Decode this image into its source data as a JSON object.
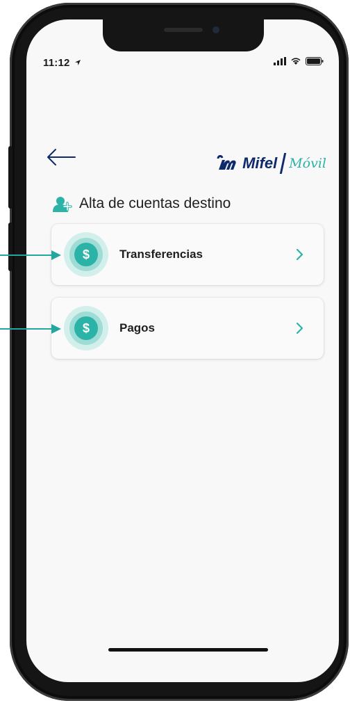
{
  "status": {
    "time": "11:12"
  },
  "header": {
    "brand": "Mifel",
    "brand_sub": "Móvil"
  },
  "section": {
    "title": "Alta de cuentas destino"
  },
  "options": [
    {
      "label": "Transferencias",
      "icon": "$"
    },
    {
      "label": "Pagos",
      "icon": "$"
    }
  ],
  "colors": {
    "accent": "#2bb3a8",
    "brand": "#0e2a6b"
  }
}
